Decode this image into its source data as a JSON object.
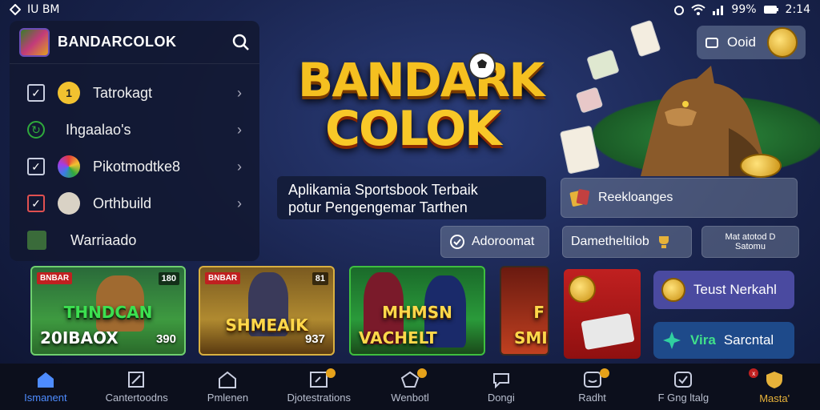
{
  "status_bar": {
    "left_text": "IU BM",
    "battery": "99%",
    "time": "2:14"
  },
  "sidebar": {
    "title": "BANDARCOLOK",
    "items": [
      {
        "label": "Tatrokagt",
        "badge_color": "#f2c230",
        "badge_text": "1"
      },
      {
        "label": "Ihgaalao's",
        "badge_color": "#2faa3c",
        "badge_text": ""
      },
      {
        "label": "Pikotmodtke8",
        "badge_color": "#6f6ae0",
        "badge_text": ""
      },
      {
        "label": "Orthbuild",
        "badge_color": "#cfcfcf",
        "badge_text": ""
      }
    ],
    "footer_item": "Warriaado"
  },
  "hero": {
    "line1": "BANDARK",
    "line2": "COLOK",
    "tagline_line1": "Aplikamia Sportsbook Terbaik",
    "tagline_line2": "potur Pengengemar Tarthen"
  },
  "account_button": {
    "label": "Ooid"
  },
  "side_buttons": {
    "redirect": "Reekloanges",
    "download": "Adoroomat",
    "promo": "Dametheltilob",
    "misc_line1": "Mat atotod D",
    "misc_line2": "Satomu"
  },
  "tiles": [
    {
      "title": "THNDCAN",
      "sub": "20IBAOX",
      "badge": "BNBAR",
      "tag": "180",
      "num": "390"
    },
    {
      "title": "SHMEAIK",
      "sub": "",
      "badge": "BNBAR",
      "tag": "81",
      "num": "937"
    },
    {
      "title": "MHMSN",
      "sub": "VACHELT",
      "badge": "",
      "tag": "",
      "num": ""
    },
    {
      "title": "F",
      "sub": "SMIG",
      "badge": "",
      "tag": "",
      "num": ""
    }
  ],
  "right_cards": {
    "card1": "Teust Nerkahl",
    "card2_green": "Vira",
    "card2_white": "Sarcntal"
  },
  "bottom_nav": [
    {
      "label": "Ismanent",
      "icon": "home-icon",
      "active": true,
      "badge": false
    },
    {
      "label": "Cantertoodns",
      "icon": "edit-icon",
      "active": false,
      "badge": false
    },
    {
      "label": "Pmlenen",
      "icon": "house-outline-icon",
      "active": false,
      "badge": false
    },
    {
      "label": "Djotestrations",
      "icon": "box-arrow-icon",
      "active": false,
      "badge": true
    },
    {
      "label": "Wenbotl",
      "icon": "pentagon-icon",
      "active": false,
      "badge": true
    },
    {
      "label": "Dongi",
      "icon": "chat-icon",
      "active": false,
      "badge": false
    },
    {
      "label": "Radht",
      "icon": "smile-icon",
      "active": false,
      "badge": true
    },
    {
      "label": "F Gng ltalg",
      "icon": "check-box-icon",
      "active": false,
      "badge": false
    },
    {
      "label": "Masta'",
      "icon": "shield-icon",
      "active": false,
      "badge": true
    }
  ],
  "colors": {
    "accent": "#4e8cff",
    "gold": "#f5c020",
    "tile_border": "#6fcf6f"
  }
}
